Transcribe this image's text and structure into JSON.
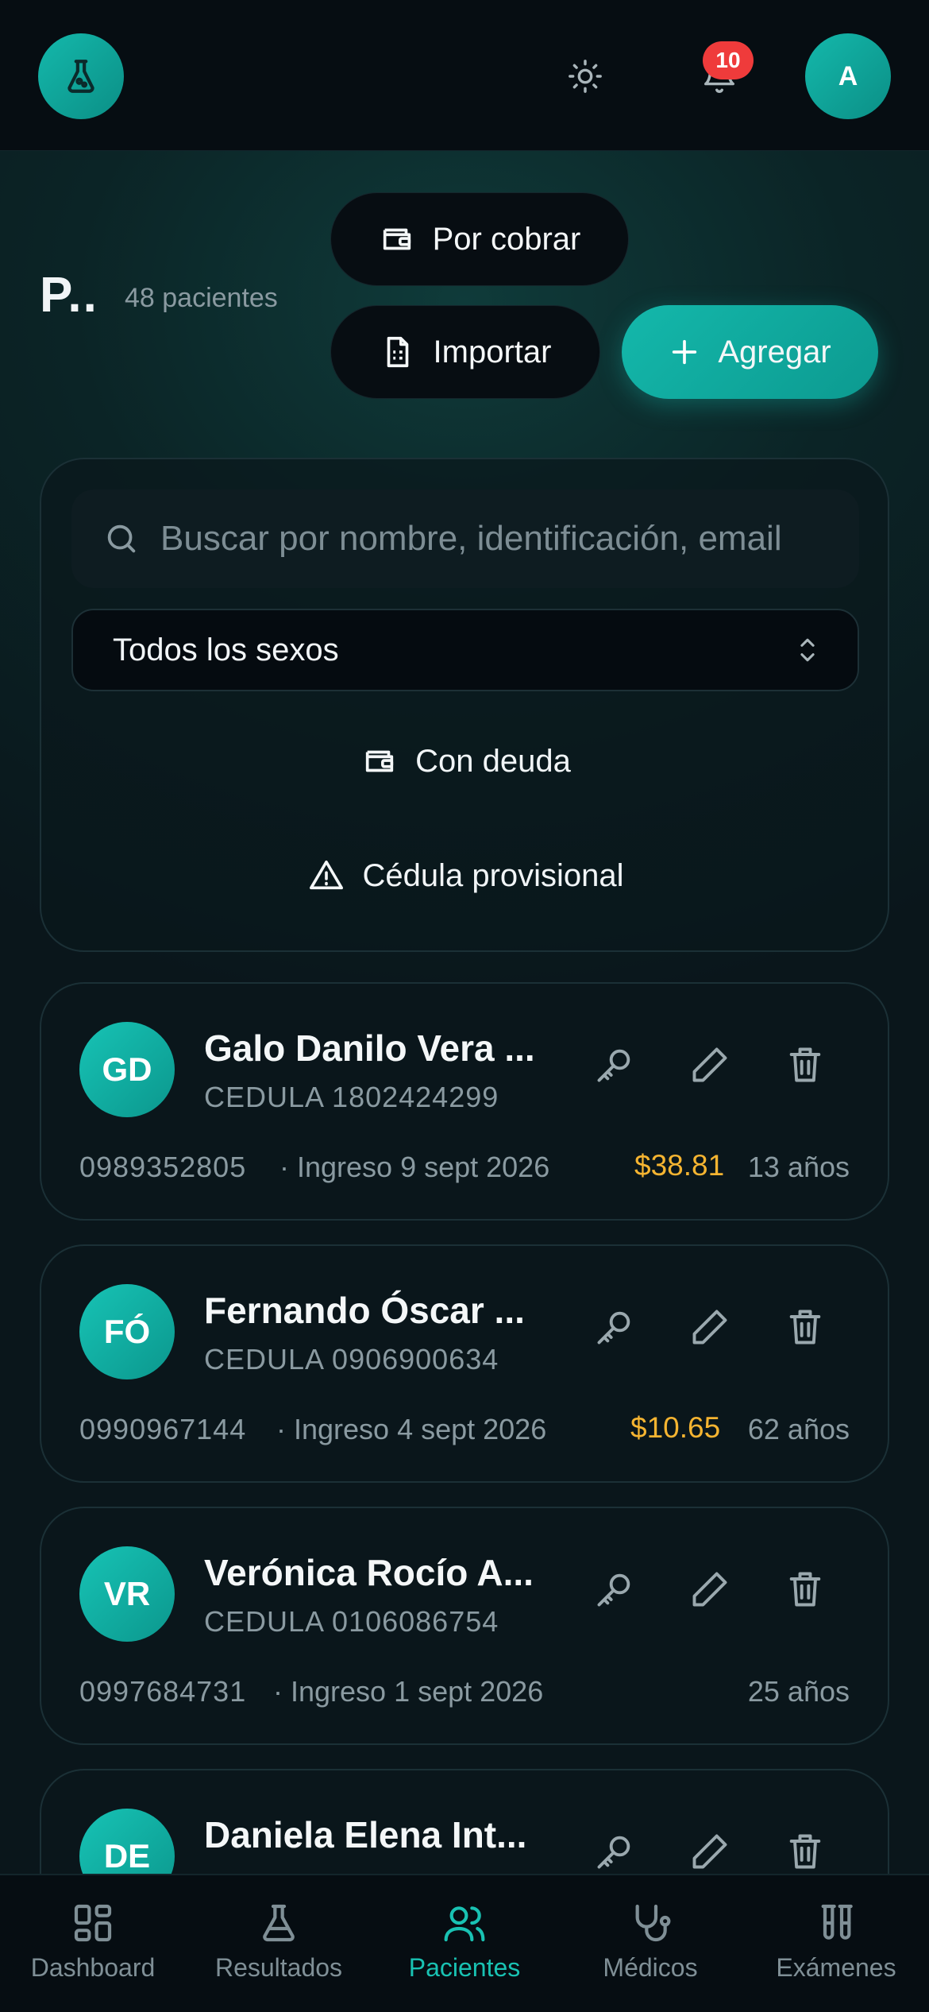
{
  "header": {
    "avatar_initial": "A",
    "notification_count": "10",
    "logo_icon": "flask-icon",
    "theme_icon": "sun-icon",
    "notification_icon": "bell-icon"
  },
  "page": {
    "title": "P..",
    "subtitle": "48 pacientes"
  },
  "actions": {
    "por_cobrar": "Por cobrar",
    "importar": "Importar",
    "agregar": "Agregar"
  },
  "filters": {
    "search_placeholder": "Buscar por nombre, identificación, email",
    "sex_select": "Todos los sexos",
    "con_deuda": "Con deuda",
    "cedula_provisional": "Cédula provisional"
  },
  "patients": [
    {
      "initials": "GD",
      "name": "Galo Danilo Vera ...",
      "id": "CEDULA 1802424299",
      "phone": "0989352805",
      "ingreso": "· Ingreso 9 sept 2026",
      "debt": "$38.81",
      "age": "13 años"
    },
    {
      "initials": "FÓ",
      "name": "Fernando Óscar ...",
      "id": "CEDULA 0906900634",
      "phone": "0990967144",
      "ingreso": "· Ingreso 4 sept 2026",
      "debt": "$10.65",
      "age": "62 años"
    },
    {
      "initials": "VR",
      "name": "Verónica Rocío A...",
      "id": "CEDULA 0106086754",
      "phone": "0997684731",
      "ingreso": "· Ingreso 1 sept 2026",
      "debt": "",
      "age": "25 años"
    },
    {
      "initials": "DE",
      "name": "Daniela Elena Int...",
      "id": "",
      "phone": "",
      "ingreso": "",
      "debt": "",
      "age": ""
    }
  ],
  "nav": [
    {
      "label": "Dashboard",
      "icon": "dashboard-icon"
    },
    {
      "label": "Resultados",
      "icon": "flask-icon"
    },
    {
      "label": "Pacientes",
      "icon": "users-icon",
      "active": true
    },
    {
      "label": "Médicos",
      "icon": "stethoscope-icon"
    },
    {
      "label": "Exámenes",
      "icon": "test-tubes-icon"
    }
  ],
  "colors": {
    "accent": "#14b8ab",
    "debt": "#f5b431",
    "badge": "#ef3b3b"
  }
}
